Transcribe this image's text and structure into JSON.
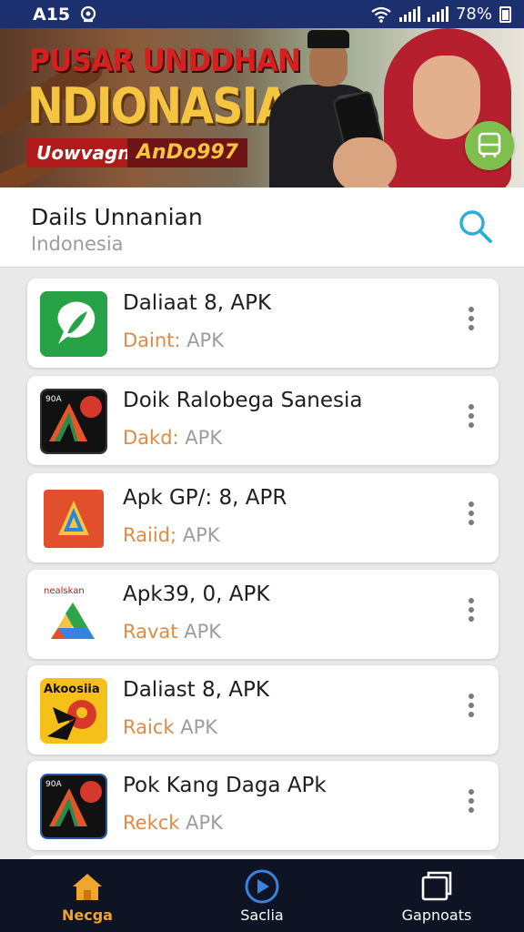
{
  "status_bar": {
    "time": "A15",
    "battery": "78%"
  },
  "banner": {
    "title_line1": "PUSAR UNDDHAN",
    "title_line2": "NDIONASIA",
    "tag1": "Uowvagn",
    "tag2": "AnDo997"
  },
  "header": {
    "title": "Dails Unnanian",
    "subtitle": "Indonesia"
  },
  "apps": [
    {
      "name": "Daliaat 8, APK",
      "meta_colored": "Daint:",
      "meta_gray": "APK",
      "icon": "chat-leaf-icon"
    },
    {
      "name": "Doik Ralobega Sanesia",
      "meta_colored": "Dakd:",
      "meta_gray": "APK",
      "icon": "a-tent-icon",
      "icon_text": "90A"
    },
    {
      "name": "Apk GP/: 8, APR",
      "meta_colored": "Raiid;",
      "meta_gray": "APK",
      "icon": "a-triangle-icon"
    },
    {
      "name": "Apk39, 0, APK",
      "meta_colored": "Ravat",
      "meta_gray": "APK",
      "icon": "drive-triangle-icon",
      "icon_text": "nealskan"
    },
    {
      "name": "Daliast 8, APK",
      "meta_colored": "Raick",
      "meta_gray": "APK",
      "icon": "yellow-nine-icon",
      "icon_text": "Akoosiia"
    },
    {
      "name": "Pok Kang Daga APk",
      "meta_colored": "Rekck",
      "meta_gray": "APK",
      "icon": "a-tent-icon",
      "icon_text": "90A"
    }
  ],
  "bottom_nav": [
    {
      "label": "Necga",
      "icon": "home-icon",
      "active": true
    },
    {
      "label": "Saclia",
      "icon": "play-circle-icon",
      "active": false
    },
    {
      "label": "Gapnoats",
      "icon": "windows-icon",
      "active": false
    }
  ],
  "colors": {
    "status_bar": "#1c2f6e",
    "accent_orange": "#e08a45",
    "search_blue": "#2ab0d6",
    "nav_bg": "#0e1424",
    "nav_active": "#f0a52d",
    "bus_green": "#7fbf4d"
  }
}
